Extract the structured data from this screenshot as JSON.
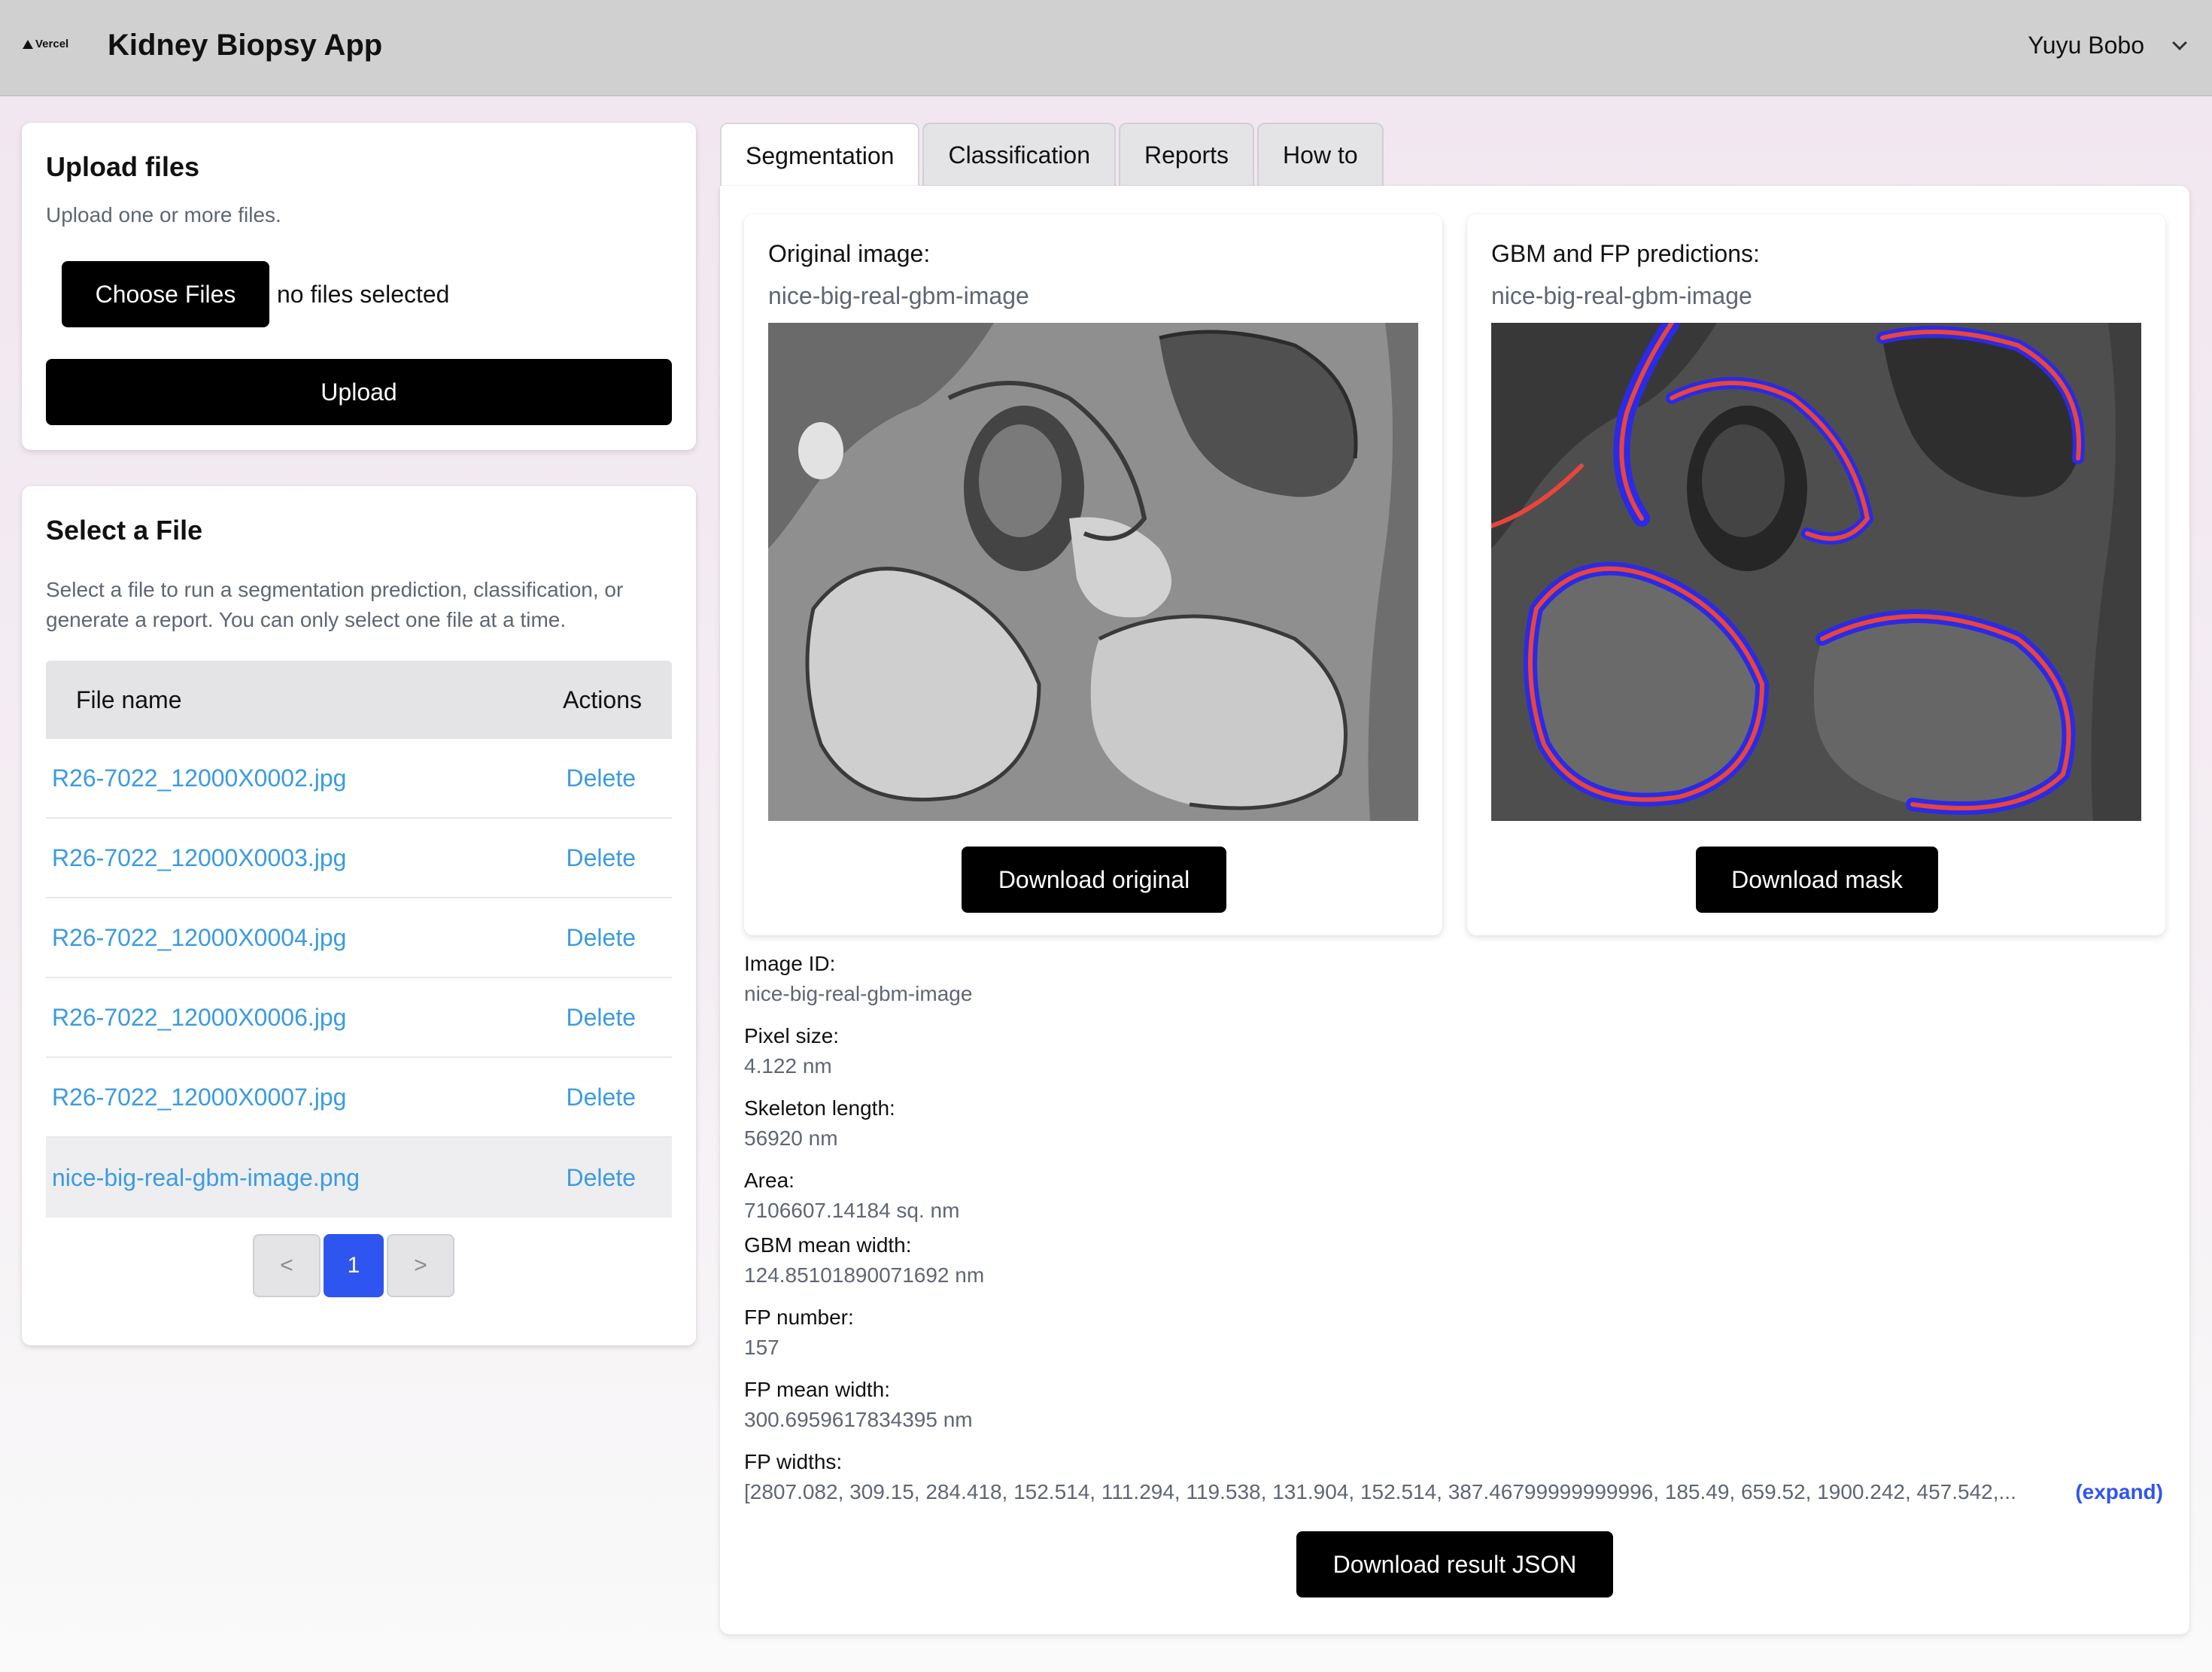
{
  "header": {
    "logo_text": "Vercel",
    "app_title": "Kidney Biopsy App",
    "user_name": "Yuyu Bobo"
  },
  "upload": {
    "title": "Upload files",
    "subtitle": "Upload one or more files.",
    "choose_label": "Choose Files",
    "no_files_text": "no files selected",
    "upload_label": "Upload"
  },
  "select": {
    "title": "Select a File",
    "description": "Select a file to run a segmentation prediction, classification, or generate a report. You can only select one file at a time.",
    "columns": [
      "File name",
      "Actions"
    ],
    "files": [
      {
        "name": "R26-7022_12000X0002.jpg",
        "action": "Delete"
      },
      {
        "name": "R26-7022_12000X0003.jpg",
        "action": "Delete"
      },
      {
        "name": "R26-7022_12000X0004.jpg",
        "action": "Delete"
      },
      {
        "name": "R26-7022_12000X0006.jpg",
        "action": "Delete"
      },
      {
        "name": "R26-7022_12000X0007.jpg",
        "action": "Delete"
      },
      {
        "name": "nice-big-real-gbm-image.png",
        "action": "Delete"
      }
    ],
    "selected_index": 5,
    "pagination": {
      "prev": "<",
      "current": "1",
      "next": ">"
    }
  },
  "tabs": [
    {
      "label": "Segmentation",
      "active": true
    },
    {
      "label": "Classification",
      "active": false
    },
    {
      "label": "Reports",
      "active": false
    },
    {
      "label": "How to",
      "active": false
    }
  ],
  "segmentation": {
    "original": {
      "label": "Original image:",
      "image_name": "nice-big-real-gbm-image",
      "download_label": "Download original"
    },
    "prediction": {
      "label": "GBM and FP predictions:",
      "image_name": "nice-big-real-gbm-image",
      "download_label": "Download mask",
      "colors": {
        "gbm": "#e8453c",
        "fp": "#2a2ae8"
      }
    },
    "results": {
      "image_id_label": "Image ID:",
      "image_id": "nice-big-real-gbm-image",
      "pixel_size_label": "Pixel size:",
      "pixel_size": "4.122 nm",
      "skeleton_length_label": "Skeleton length:",
      "skeleton_length": "56920 nm",
      "area_label": "Area:",
      "area": "7106607.14184 sq. nm",
      "gbm_mean_width_label": "GBM mean width:",
      "gbm_mean_width": "124.85101890071692 nm",
      "fp_number_label": "FP number:",
      "fp_number": "157",
      "fp_mean_width_label": "FP mean width:",
      "fp_mean_width": "300.6959617834395 nm",
      "fp_widths_label": "FP widths:",
      "fp_widths": "[2807.082, 309.15, 284.418, 152.514, 111.294, 119.538, 131.904, 152.514, 387.46799999999996, 185.49, 659.52, 1900.242, 457.542,...",
      "expand_label": "(expand)"
    },
    "download_json_label": "Download result JSON"
  }
}
